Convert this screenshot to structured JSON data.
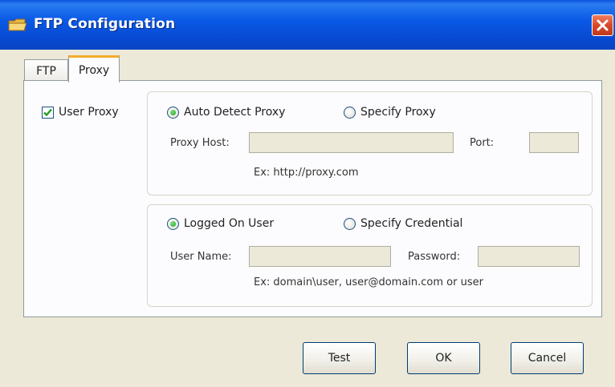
{
  "window": {
    "title": "FTP Configuration",
    "title_icon": "folder-icon",
    "close_icon": "close-icon"
  },
  "tabs": [
    {
      "label": "FTP",
      "selected": false
    },
    {
      "label": "Proxy",
      "selected": true
    }
  ],
  "proxy": {
    "use_proxy": {
      "label": "User Proxy",
      "checked": true
    },
    "detect": {
      "auto_label": "Auto Detect Proxy",
      "auto_selected": true,
      "specify_label": "Specify Proxy",
      "specify_selected": false
    },
    "host_label": "Proxy Host:",
    "host_value": "",
    "port_label": "Port:",
    "port_value": "",
    "host_hint": "Ex: http://proxy.com",
    "credentials": {
      "logged_on_label": "Logged On User",
      "logged_on_selected": true,
      "specify_label": "Specify Credential",
      "specify_selected": false
    },
    "username_label": "User Name:",
    "username_value": "",
    "password_label": "Password:",
    "password_value": "",
    "credential_hint": "Ex: domain\\user, user@domain.com or user"
  },
  "buttons": {
    "test": "Test",
    "ok": "OK",
    "cancel": "Cancel"
  },
  "colors": {
    "titlebar": "#0a52e0",
    "dialog_bg": "#ece9d8",
    "panel_bg": "#fcfcfe",
    "tab_highlight": "#f4ac2c",
    "radio_selected": "#21a121",
    "checkmark": "#21a121",
    "close_button": "#d8482a"
  }
}
